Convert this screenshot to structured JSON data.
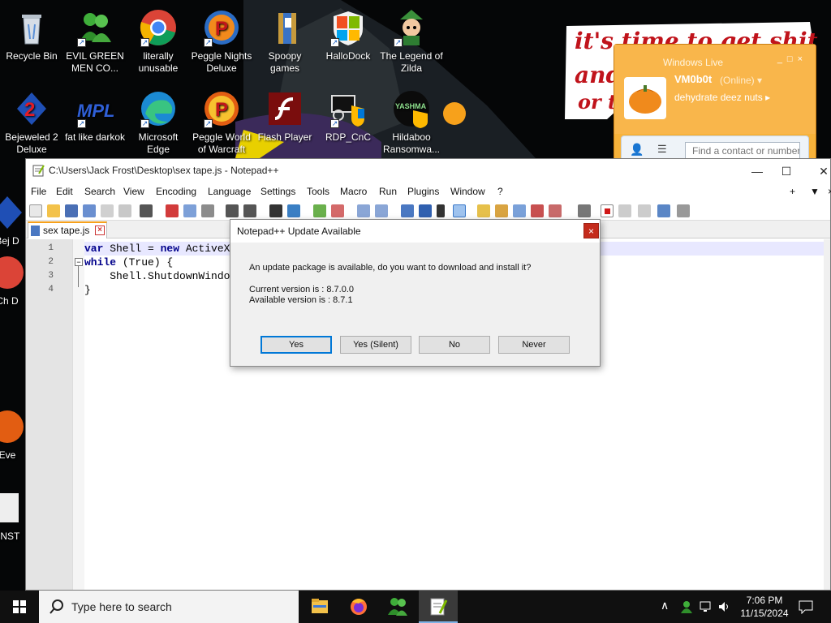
{
  "desktop": {
    "icons": [
      {
        "name": "recycle-bin",
        "label": "Recycle Bin",
        "icon": "recycle-bin-icon"
      },
      {
        "name": "evil-green-men",
        "label": "EVIL GREEN MEN CO...",
        "icon": "msn-buddies-icon"
      },
      {
        "name": "chrome",
        "label": "literally unusable",
        "icon": "chrome-icon"
      },
      {
        "name": "peggle-nights",
        "label": "Peggle Nights Deluxe",
        "icon": "peggle-icon"
      },
      {
        "name": "spoopy-games",
        "label": "Spoopy games",
        "icon": "folder-icon"
      },
      {
        "name": "hallodock",
        "label": "HalloDock",
        "icon": "windows-shield-icon"
      },
      {
        "name": "legend-of-zilda",
        "label": "The Legend of Zilda",
        "icon": "game-character-icon"
      },
      {
        "name": "bejeweled-2",
        "label": "Bejeweled 2 Deluxe",
        "icon": "bejeweled-icon"
      },
      {
        "name": "fat-like-darkok",
        "label": "fat like darkok",
        "icon": "mpl-logo-icon"
      },
      {
        "name": "microsoft-edge",
        "label": "Microsoft Edge",
        "icon": "edge-icon"
      },
      {
        "name": "peggle-world",
        "label": "Peggle World of Warcraft",
        "icon": "peggle-icon"
      },
      {
        "name": "flash-player",
        "label": "Flash Player",
        "icon": "flash-icon"
      },
      {
        "name": "rdp-cnc",
        "label": "RDP_CnC",
        "icon": "remote-desktop-icon"
      },
      {
        "name": "hildaboo",
        "label": "Hildaboo Ransomwa...",
        "icon": "yashma-shield-icon"
      },
      {
        "name": "partial-bej",
        "label": "Bej D",
        "icon": "bejeweled-icon"
      },
      {
        "name": "partial-chrome",
        "label": "Ch D",
        "icon": "chrome-icon"
      },
      {
        "name": "partial-ever",
        "label": "Eve",
        "icon": "edge-icon"
      },
      {
        "name": "partial-inst",
        "label": "!INST",
        "icon": "installer-icon"
      }
    ],
    "banner_text": [
      "it's time to get shit",
      "and",
      "or t"
    ]
  },
  "messenger": {
    "title": "Windows Live",
    "display_name": "VM0b0t",
    "status": "(Online) ▾",
    "personal_message": "dehydrate deez nuts ▸",
    "search_placeholder": "Find a contact or number"
  },
  "notepad": {
    "window_title": "C:\\Users\\Jack Frost\\Desktop\\sex tape.js - Notepad++",
    "menu": [
      "File",
      "Edit",
      "Search",
      "View",
      "Encoding",
      "Language",
      "Settings",
      "Tools",
      "Macro",
      "Run",
      "Plugins",
      "Window",
      "?"
    ],
    "menu_right": [
      "+",
      "▼",
      "×"
    ],
    "tab_label": "sex tape.js",
    "lines": [
      {
        "num": "1",
        "code": "var Shell = new ActiveX"
      },
      {
        "num": "2",
        "code": "while (True) {"
      },
      {
        "num": "3",
        "code": "    Shell.ShutdownWindo"
      },
      {
        "num": "4",
        "code": "}"
      }
    ]
  },
  "dialog": {
    "title": "Notepad++ Update Available",
    "message": "An update package is available, do you want to download and install it?",
    "current_version": "Current version is   : 8.7.0.0",
    "available_version": "Available version is : 8.7.1",
    "buttons": [
      "Yes",
      "Yes (Silent)",
      "No",
      "Never"
    ]
  },
  "taskbar": {
    "search_placeholder": "Type here to search",
    "time": "7:06 PM",
    "date": "11/15/2024"
  },
  "colors": {
    "accent": "#0078d7",
    "taskbar": "#101010",
    "dialog_close": "#c42b1c",
    "msn_orange": "#f7b23a"
  }
}
